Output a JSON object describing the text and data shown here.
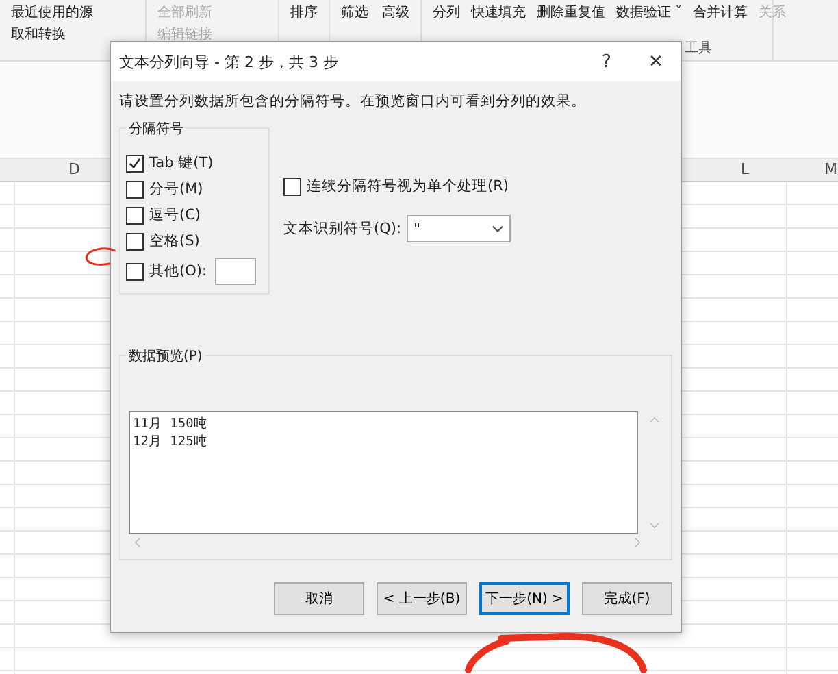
{
  "ribbon": {
    "groups": [
      {
        "items": [
          {
            "label": "最近使用的源",
            "disabled": false
          },
          {
            "label": "取和转换",
            "disabled": false
          }
        ]
      },
      {
        "items": [
          {
            "label": "全部刷新",
            "disabled": true
          },
          {
            "label": "编辑链接",
            "disabled": true
          }
        ]
      },
      {
        "items": [
          {
            "label": "排序",
            "disabled": false
          }
        ]
      },
      {
        "items": [
          {
            "label": "筛选",
            "disabled": false
          },
          {
            "label": "高级",
            "disabled": false
          }
        ]
      },
      {
        "items": [
          {
            "label": "分列",
            "disabled": false
          },
          {
            "label": "快速填充",
            "disabled": false
          },
          {
            "label": "删除重复值",
            "disabled": false
          },
          {
            "label": "数据验证 ˇ",
            "disabled": false
          },
          {
            "label": "合并计算",
            "disabled": false
          },
          {
            "label": "关系",
            "disabled": true
          }
        ],
        "caption": "工具"
      }
    ]
  },
  "sheet": {
    "columns": [
      "D",
      "L",
      "M"
    ]
  },
  "dialog": {
    "title": "文本分列向导 - 第 2 步，共 3 步",
    "help": "?",
    "close": "✕",
    "instruction": "请设置分列数据所包含的分隔符号。在预览窗口内可看到分列的效果。",
    "delimiters": {
      "legend": "分隔符号",
      "items": [
        {
          "label": "Tab 键(T)",
          "checked": true,
          "kind": "plain"
        },
        {
          "label": "分号(M)",
          "checked": false,
          "kind": "plain"
        },
        {
          "label": "逗号(C)",
          "checked": false,
          "kind": "plain"
        },
        {
          "label": "空格(S)",
          "checked": false,
          "kind": "plain"
        },
        {
          "label": "其他(O):",
          "checked": false,
          "kind": "other"
        }
      ]
    },
    "consecutive": {
      "label": "连续分隔符号视为单个处理(R)",
      "checked": false
    },
    "qualifier": {
      "label": "文本识别符号(Q):",
      "value": "\""
    },
    "preview": {
      "legend": "数据预览(P)",
      "lines": [
        "11月 150吨",
        "12月 125吨"
      ]
    },
    "buttons": [
      {
        "label": "取消",
        "selected": false
      },
      {
        "label": "< 上一步(B)",
        "selected": false
      },
      {
        "label": "下一步(N) >",
        "selected": true
      },
      {
        "label": "完成(F)",
        "selected": false
      }
    ]
  }
}
